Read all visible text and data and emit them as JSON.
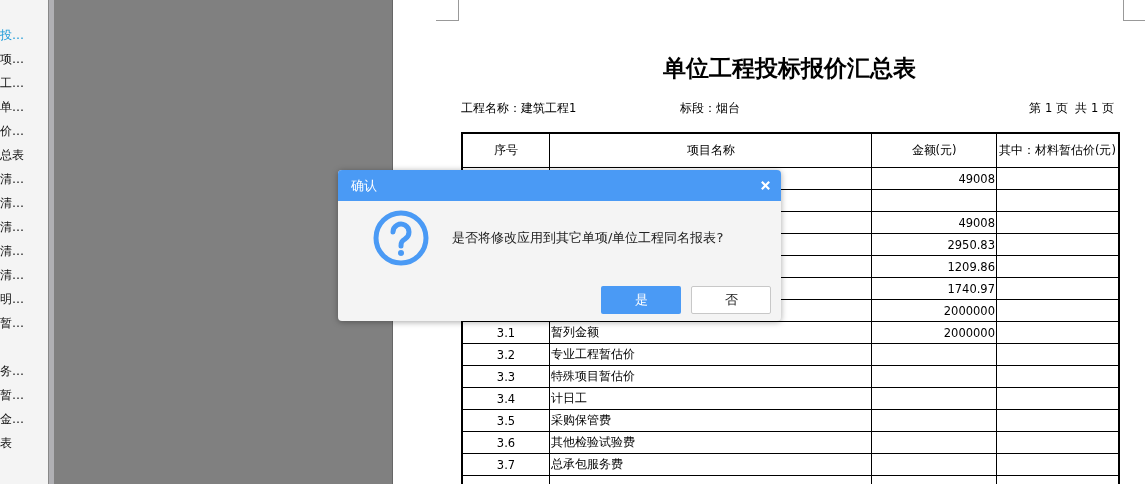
{
  "sidebar": {
    "items": [
      {
        "label": "投…",
        "selected": true,
        "group_start": false
      },
      {
        "label": "项…",
        "selected": false,
        "group_start": false
      },
      {
        "label": "工…",
        "selected": false,
        "group_start": false
      },
      {
        "label": "单…",
        "selected": false,
        "group_start": false
      },
      {
        "label": "价…",
        "selected": false,
        "group_start": false
      },
      {
        "label": "总表",
        "selected": false,
        "group_start": false
      },
      {
        "label": "清…",
        "selected": false,
        "group_start": false
      },
      {
        "label": "清…",
        "selected": false,
        "group_start": false
      },
      {
        "label": "清…",
        "selected": false,
        "group_start": false
      },
      {
        "label": "清…",
        "selected": false,
        "group_start": false
      },
      {
        "label": "清…",
        "selected": false,
        "group_start": false
      },
      {
        "label": "明…",
        "selected": false,
        "group_start": false
      },
      {
        "label": "暂…",
        "selected": false,
        "group_start": false
      },
      {
        "label": "务…",
        "selected": false,
        "group_start": true
      },
      {
        "label": "暂…",
        "selected": false,
        "group_start": false
      },
      {
        "label": "金…",
        "selected": false,
        "group_start": false
      },
      {
        "label": "表",
        "selected": false,
        "group_start": false
      }
    ]
  },
  "report": {
    "title": "单位工程投标报价汇总表",
    "project": "工程名称：建筑工程1",
    "section": "标段：烟台",
    "page_info": "第 1 页  共 1 页",
    "table": {
      "columns": [
        "序号",
        "项目名称",
        "金额(元)",
        "其中：材料暂估价(元)"
      ],
      "rows": [
        {
          "no": "",
          "name": "",
          "amount": "49008"
        },
        {
          "no": "",
          "name": "",
          "amount": ""
        },
        {
          "no": "",
          "name": "",
          "amount": "49008"
        },
        {
          "no": "",
          "name": "",
          "amount": "2950.83"
        },
        {
          "no": "",
          "name": "",
          "amount": "1209.86"
        },
        {
          "no": "",
          "name": "",
          "amount": "1740.97"
        },
        {
          "no": "",
          "name": "",
          "amount": "2000000"
        },
        {
          "no": "3.1",
          "name": "暂列金额",
          "amount": "2000000"
        },
        {
          "no": "3.2",
          "name": "专业工程暂估价",
          "amount": ""
        },
        {
          "no": "3.3",
          "name": "特殊项目暂估价",
          "amount": ""
        },
        {
          "no": "3.4",
          "name": "计日工",
          "amount": ""
        },
        {
          "no": "3.5",
          "name": "采购保管费",
          "amount": ""
        },
        {
          "no": "3.6",
          "name": "其他检验试验费",
          "amount": ""
        },
        {
          "no": "3.7",
          "name": "总承包服务费",
          "amount": ""
        },
        {
          "no": "",
          "name": "",
          "amount": ""
        }
      ]
    }
  },
  "dialog": {
    "title": "确认",
    "message": "是否将修改应用到其它单项/单位工程同名报表?",
    "buttons": [
      {
        "label": "是",
        "kind": "primary"
      },
      {
        "label": "否",
        "kind": "secondary"
      }
    ]
  }
}
